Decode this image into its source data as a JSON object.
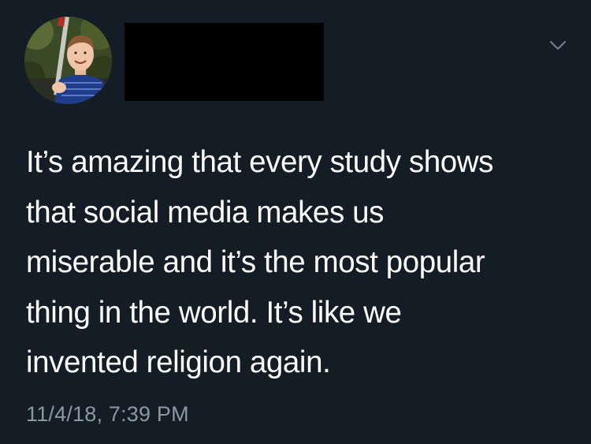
{
  "tweet": {
    "body_lines": [
      "It’s amazing that every study shows",
      "that social media makes us",
      "miserable and it’s the most popular",
      "thing in the world. It’s like we",
      "invented religion again."
    ],
    "timestamp": "11/4/18, 7:39 PM"
  },
  "icons": {
    "menu": "chevron-down-icon",
    "avatar": "profile-photo"
  },
  "colors": {
    "background": "#141d26",
    "text": "#ffffff",
    "muted": "#8899a6",
    "redaction": "#000000"
  }
}
